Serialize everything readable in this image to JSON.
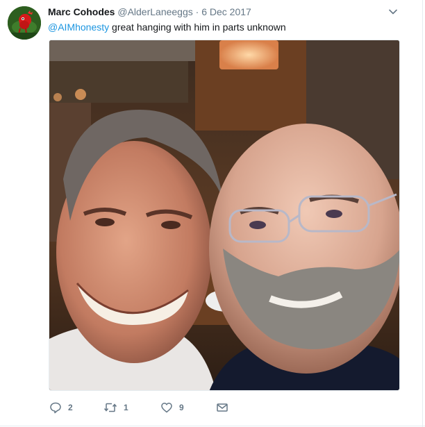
{
  "tweet": {
    "author_name": "Marc Cohodes",
    "author_handle": "@AlderLaneeggs",
    "separator": "·",
    "date": "6 Dec 2017",
    "mention": "@AIMhonesty",
    "text": " great hanging with him in parts unknown",
    "avatar_icon": "red-rooster-avatar",
    "more_icon": "chevron-down-icon",
    "photo_description_icon": "selfie-photo"
  },
  "actions": {
    "reply": {
      "icon": "reply-icon",
      "count": "2"
    },
    "retweet": {
      "icon": "retweet-icon",
      "count": "1"
    },
    "like": {
      "icon": "heart-icon",
      "count": "9"
    },
    "dm": {
      "icon": "envelope-icon"
    }
  },
  "colors": {
    "link": "#1b95e0",
    "muted": "#657786",
    "text": "#14171a"
  }
}
